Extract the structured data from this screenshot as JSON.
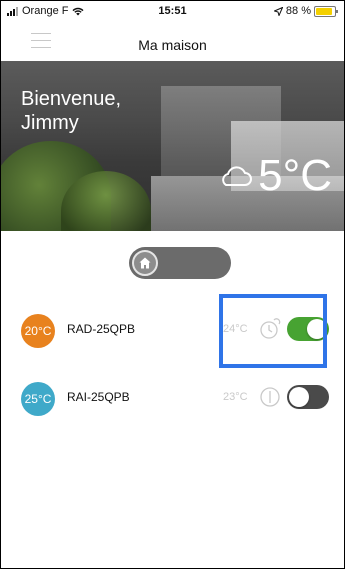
{
  "status_bar": {
    "carrier": "Orange F",
    "time": "15:51",
    "battery": "88 %",
    "battery_level": 0.88
  },
  "nav": {
    "title": "Ma maison"
  },
  "hero": {
    "welcome_line1": "Bienvenue,",
    "welcome_line2": "Jimmy",
    "outdoor_temp": "5°C",
    "weather_icon": "cloud-icon"
  },
  "mode_toggle": {
    "icon": "home-icon"
  },
  "devices": [
    {
      "badge_temp": "20°C",
      "badge_color": "#e8821e",
      "name": "RAD-25QPB",
      "set_temp": "24°C",
      "mode_icon": "timer-clock-icon",
      "state": "on"
    },
    {
      "badge_temp": "25°C",
      "badge_color": "#3fa9c9",
      "name": "RAI-25QPB",
      "set_temp": "23°C",
      "mode_icon": "manual-clock-icon",
      "state": "off"
    }
  ],
  "colors": {
    "accent_green": "#47a332",
    "highlight_blue": "#2f74e8"
  }
}
